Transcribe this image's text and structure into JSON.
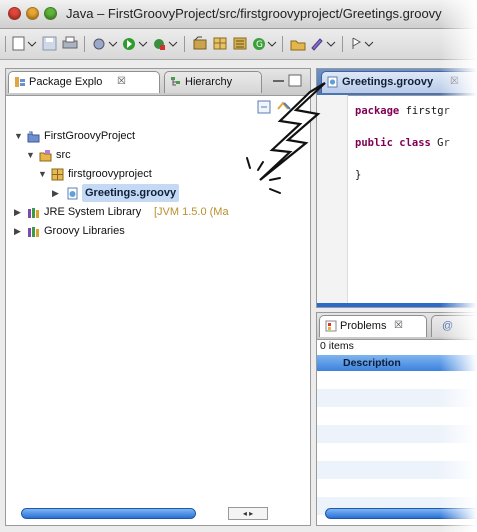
{
  "window": {
    "title": "Java – FirstGroovyProject/src/firstgroovyproject/Greetings.groovy"
  },
  "icons": {
    "close": "close-light-icon",
    "minimize": "minimize-light-icon",
    "zoom": "zoom-light-icon"
  },
  "colors": {
    "close": "#e3463a",
    "minimize": "#e8a733",
    "zoom": "#5fb53c",
    "selection": "#c4d9f4",
    "scroll_accent": "#2a70d6"
  },
  "left_pane": {
    "tabs": [
      {
        "label": "Package Explo",
        "close": "☒"
      },
      {
        "label": "Hierarchy"
      }
    ],
    "tree": [
      {
        "label": "FirstGroovyProject"
      },
      {
        "label": "src"
      },
      {
        "label": "firstgroovyproject"
      },
      {
        "label": "Greetings.groovy"
      },
      {
        "label": "JRE System Library",
        "extra": "[JVM 1.5.0 (Ma"
      },
      {
        "label": "Groovy Libraries"
      }
    ]
  },
  "editor": {
    "tab_label": "Greetings.groovy",
    "tab_close": "☒",
    "lines": [
      {
        "kw": "package",
        "rest": " firstgr"
      },
      {
        "kw": "public class",
        "rest": " Gr"
      },
      {
        "kw": "",
        "rest": "}"
      }
    ]
  },
  "problems": {
    "tab_label": "Problems",
    "tab_close": "☒",
    "second_tab": "@",
    "items_count": "0 items",
    "column_header": "Description"
  }
}
